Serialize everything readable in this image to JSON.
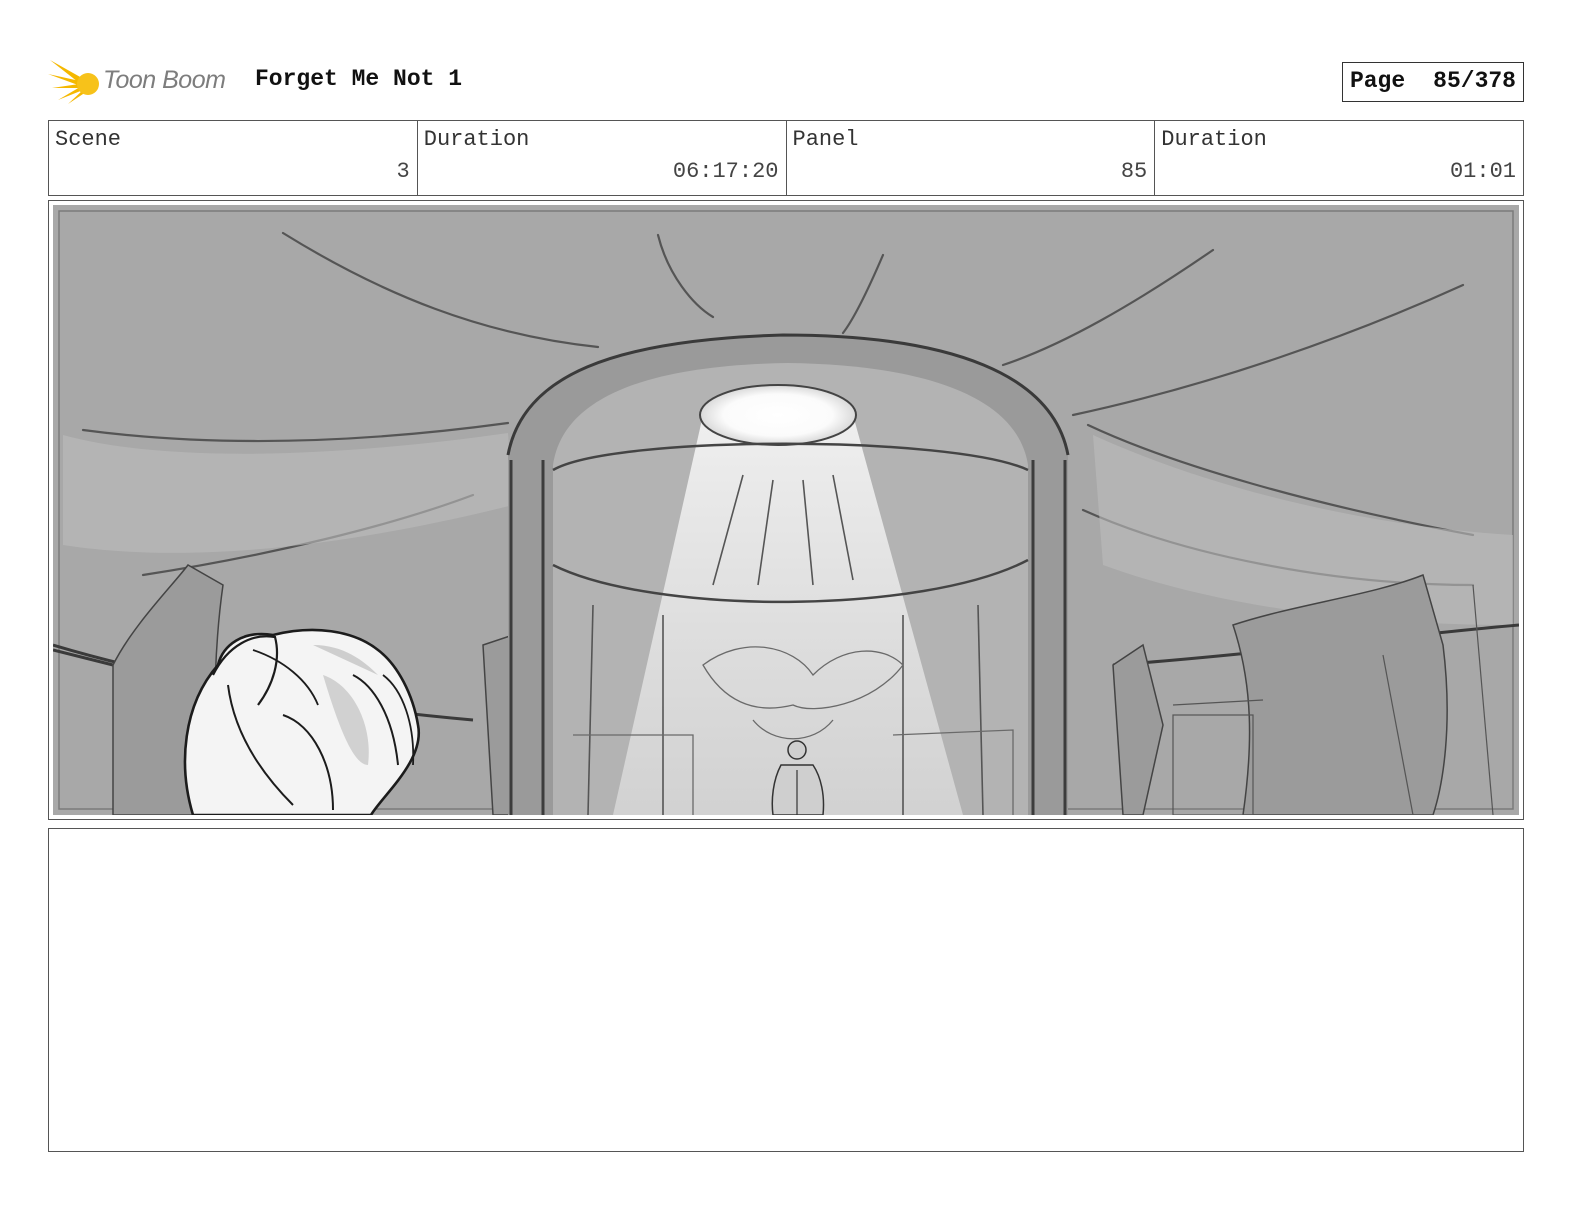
{
  "header": {
    "logo_text": "Toon Boom",
    "title": "Forget Me Not 1",
    "page_label": "Page",
    "page_value": "85/378"
  },
  "info": [
    {
      "label": "Scene",
      "value": "3"
    },
    {
      "label": "Duration",
      "value": "06:17:20"
    },
    {
      "label": "Panel",
      "value": "85"
    },
    {
      "label": "Duration",
      "value": "01:01"
    }
  ],
  "colors": {
    "logo_accent": "#f5b800",
    "sketch_background": "#a6a6a6",
    "sketch_light": "#f4f4f4",
    "line": "#2a2a2a"
  },
  "notes": {
    "text": ""
  }
}
